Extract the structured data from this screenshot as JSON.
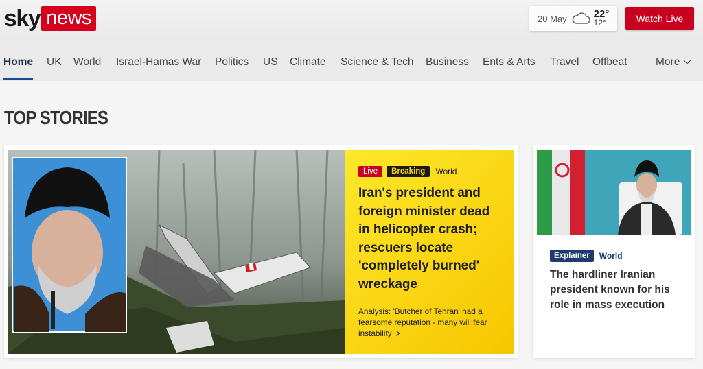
{
  "brand": {
    "logo_sky": "sky",
    "logo_news": "news",
    "accent": "#d4001e"
  },
  "weather": {
    "date": "20 May",
    "icon": "cloud-icon",
    "high": "22°",
    "low": "12°"
  },
  "header": {
    "watch_live_label": "Watch Live"
  },
  "nav": {
    "items": [
      {
        "label": "Home"
      },
      {
        "label": "UK"
      },
      {
        "label": "World"
      },
      {
        "label": "Israel-Hamas War"
      },
      {
        "label": "Politics"
      },
      {
        "label": "US"
      },
      {
        "label": "Climate"
      },
      {
        "label": "Science & Tech"
      },
      {
        "label": "Business"
      },
      {
        "label": "Ents & Arts"
      },
      {
        "label": "Travel"
      },
      {
        "label": "Offbeat"
      },
      {
        "label": "More"
      }
    ]
  },
  "section": {
    "title": "TOP STORIES"
  },
  "main_story": {
    "tag_live": "Live",
    "tag_breaking": "Breaking",
    "tag_category": "World",
    "headline": "Iran's president and foreign minister dead in helicopter crash; rescuers locate 'completely burned' wreckage",
    "analysis": "Analysis: 'Butcher of Tehran' had a fearsome reputation - many will fear instability"
  },
  "side_story": {
    "tag_type": "Explainer",
    "tag_category": "World",
    "headline": "The hardliner Iranian president known for his role in mass execution"
  }
}
